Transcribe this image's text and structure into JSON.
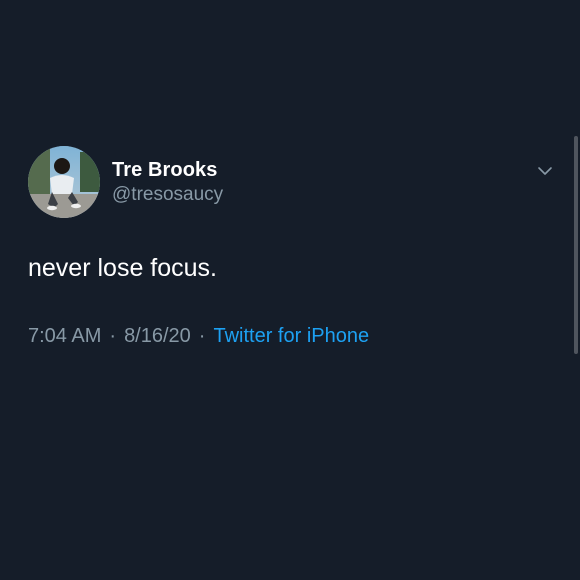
{
  "tweet": {
    "author": {
      "display_name": "Tre Brooks",
      "handle": "@tresosaucy",
      "avatar_icon": "avatar-icon"
    },
    "text": "never lose focus.",
    "meta": {
      "time": "7:04 AM",
      "date": "8/16/20",
      "separator": "·",
      "source": "Twitter for iPhone"
    },
    "menu_icon": "chevron-down-icon"
  },
  "colors": {
    "background": "#151d29",
    "primary_text": "#ffffff",
    "secondary_text": "#8899a6",
    "link": "#1da1f2"
  }
}
